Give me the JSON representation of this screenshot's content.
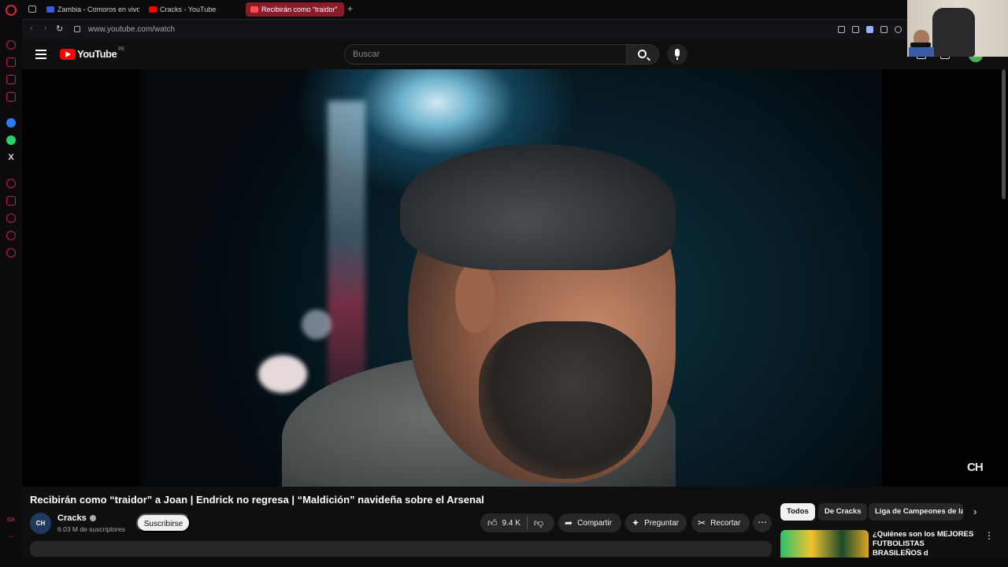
{
  "browser": {
    "tabs": [
      {
        "label": "Zambia - Comoros en vivo",
        "color": "#3b5bdb"
      },
      {
        "label": "Cracks - YouTube",
        "color": "#ff0000"
      },
      {
        "label": "Recibirán como “traidor”",
        "color": "#ff0000",
        "active": true
      }
    ],
    "new_tab": "+",
    "url": "www.youtube.com/watch",
    "sidebar_label": "GX"
  },
  "youtube": {
    "logo_text": "YouTube",
    "country": "PE",
    "search_placeholder": "Buscar"
  },
  "video": {
    "watermark": "CH",
    "title": "Recibirán como “traidor” a Joan | Endrick no regresa | “Maldición” navideña sobre el Arsenal"
  },
  "channel": {
    "avatar_text": "CH",
    "name": "Cracks",
    "subscribers": "6.03 M de suscriptores",
    "subscribe_label": "Suscribirse"
  },
  "actions": {
    "likes": "9.4 K",
    "share": "Compartir",
    "ask": "Preguntar",
    "clip": "Recortar",
    "more": "⋯"
  },
  "related": {
    "chips": [
      "Todos",
      "De Cracks",
      "Liga de Campeones de la UEFA"
    ],
    "first_title": "¿Quiénes son los MEJORES FUTBOLISTAS BRASILEÑOS d"
  },
  "colors": {
    "accent": "#ff0000",
    "opera_red": "#c8233a",
    "background": "#0f0f0f"
  }
}
